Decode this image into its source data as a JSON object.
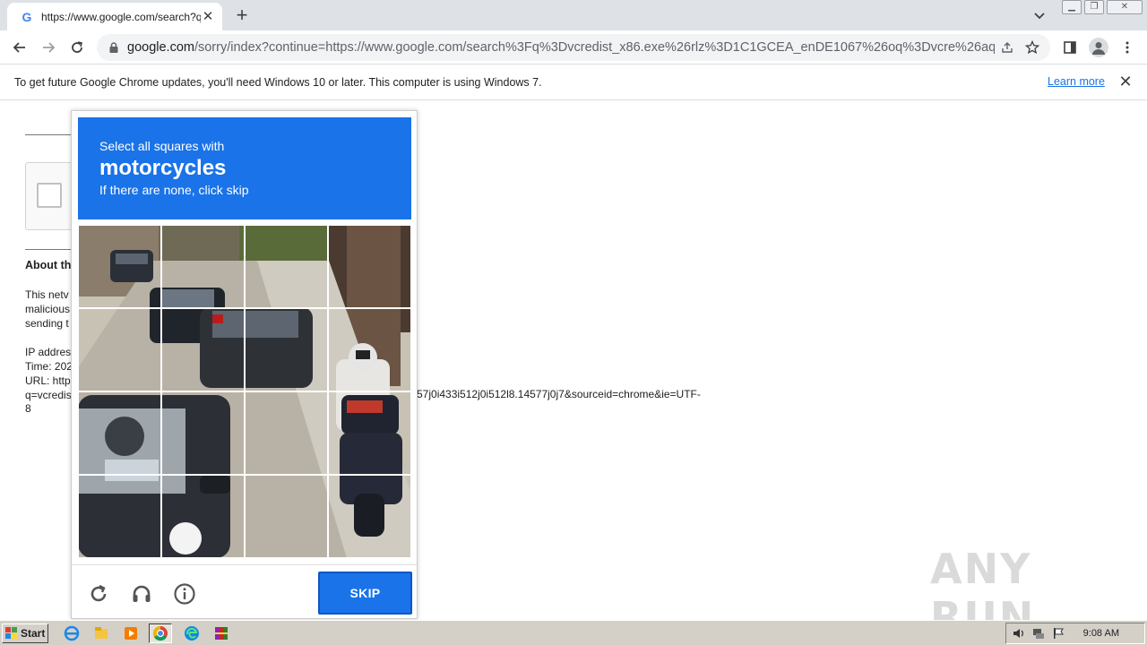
{
  "browser": {
    "tab_title": "https://www.google.com/search?q=",
    "favicon": "G",
    "url_host": "google.com",
    "url_path": "/sorry/index?continue=https://www.google.com/search%3Fq%3Dvcredist_x86.exe%26rlz%3D1C1GCEA_enDE1067%26oq%3Dvcre%26aq...",
    "icons": [
      "back-icon",
      "forward-icon",
      "reload-icon",
      "lock-icon",
      "share-icon",
      "star-icon",
      "side-panel-icon",
      "profile-icon",
      "menu-icon"
    ]
  },
  "infobar": {
    "message": "To get future Google Chrome updates, you'll need Windows 10 or later. This computer is using Windows 7.",
    "learn_more": "Learn more"
  },
  "page": {
    "about_heading": "About th",
    "para_l1": "This netv",
    "para_l2": "malicious",
    "para_l3": "sending t",
    "ip_label": "IP addres",
    "time_label": "Time: 202",
    "url_label": "URL: http",
    "url_l2": "q=vcredis",
    "url_tail": "57j0i433i512j0i512l8.14577j0j7&sourceid=chrome&ie=UTF-",
    "url_tail2": "8"
  },
  "captcha": {
    "instruction": "Select all squares with",
    "target": "motorcycles",
    "hint": "If there are none, click skip",
    "skip_label": "SKIP",
    "accent": "#1a73e8"
  },
  "watermark": "ANY RUN",
  "taskbar": {
    "start_label": "Start",
    "clock": "9:08 AM"
  }
}
